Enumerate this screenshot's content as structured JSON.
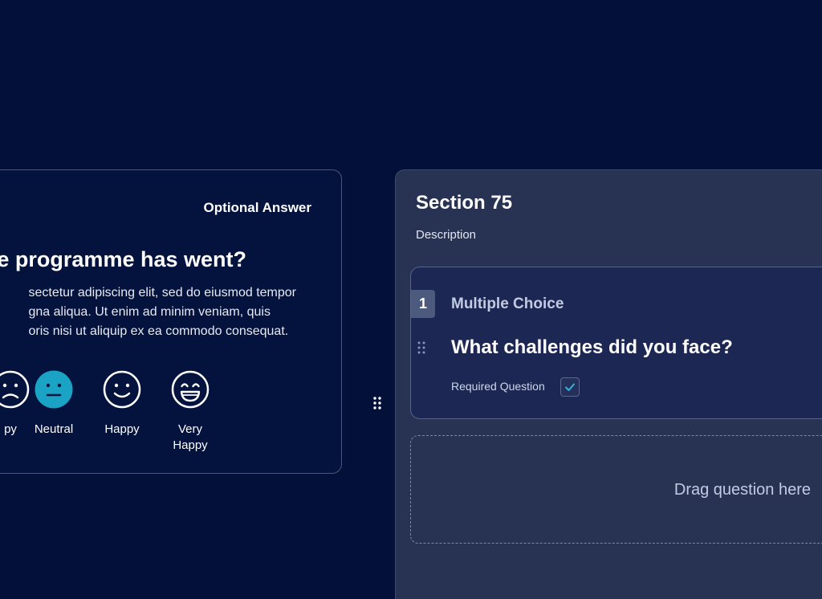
{
  "preview": {
    "optional_label": "Optional Answer",
    "title": "e programme has went?",
    "description_lines": [
      "sectetur adipiscing elit, sed do eiusmod tempor",
      "gna aliqua. Ut enim ad minim veniam, quis",
      "oris nisi ut aliquip ex ea commodo consequat."
    ],
    "rating_options": [
      {
        "label": "py",
        "icon": "unhappy-face-icon",
        "selected": false
      },
      {
        "label": "Neutral",
        "icon": "neutral-face-icon",
        "selected": true
      },
      {
        "label": "Happy",
        "icon": "happy-face-icon",
        "selected": false
      },
      {
        "label": "Very Happy",
        "icon": "very-happy-face-icon",
        "selected": false
      }
    ],
    "selected_color": "#1aa3c4"
  },
  "section": {
    "title": "Section 75",
    "description": "Description",
    "question": {
      "number": "1",
      "type": "Multiple Choice",
      "title": "What challenges did you face?",
      "required_label": "Required Question",
      "required_checked": true
    },
    "drop_zone_label": "Drag question here"
  },
  "icons": {
    "section_handle": "drag-handle-icon",
    "question_handle": "drag-handle-icon",
    "checkbox": "checkmark-icon"
  }
}
